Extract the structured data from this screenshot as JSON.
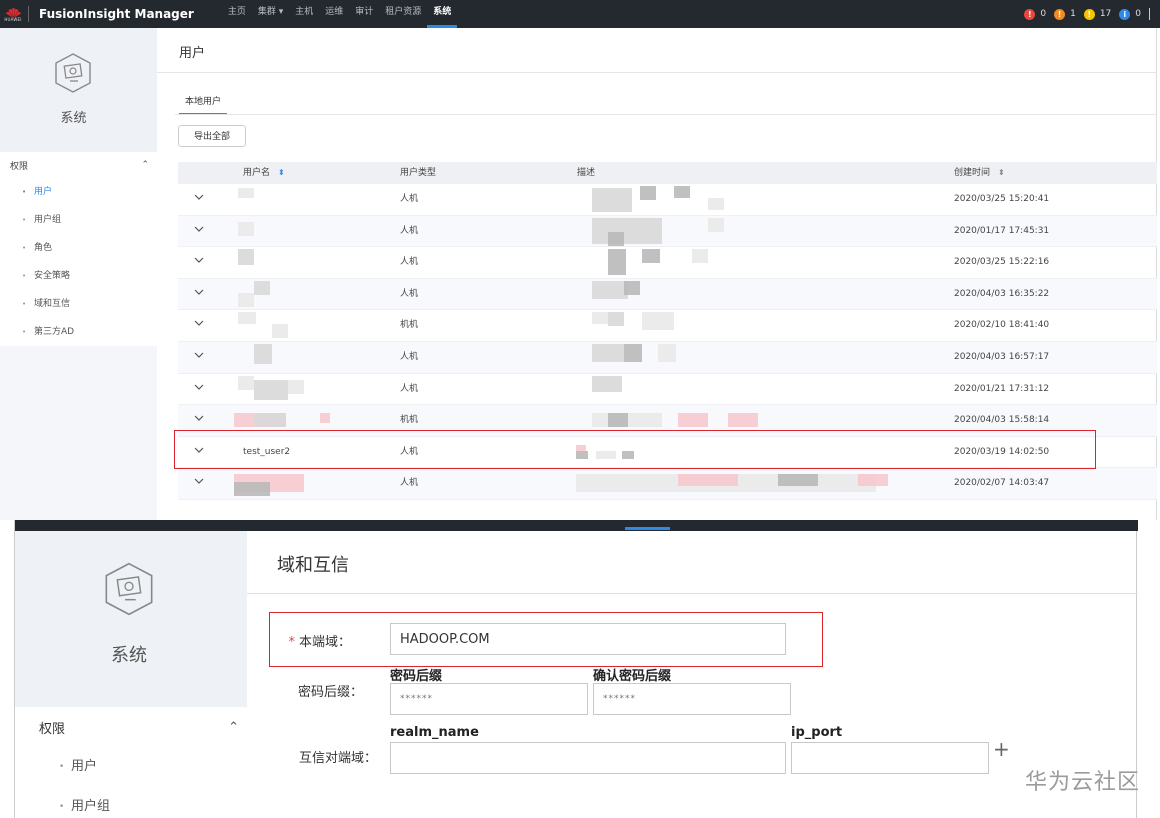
{
  "topbar": {
    "logo_text": "HUAWEI",
    "product": "FusionInsight Manager",
    "nav": [
      "主页",
      "集群 ▾",
      "主机",
      "运维",
      "审计",
      "租户资源",
      "系统"
    ],
    "active_nav": "系统",
    "alarms": [
      {
        "color": "#e5483d",
        "icon": "!",
        "count": "0"
      },
      {
        "color": "#f08a24",
        "icon": "!",
        "count": "1"
      },
      {
        "color": "#f5c400",
        "icon": "!",
        "count": "17"
      },
      {
        "color": "#2f8ae5",
        "icon": "i",
        "count": "0"
      }
    ]
  },
  "upper": {
    "sidebar": {
      "title": "系统",
      "group": "权限",
      "items": [
        "用户",
        "用户组",
        "角色",
        "安全策略",
        "域和互信",
        "第三方AD"
      ],
      "active_index": 0
    },
    "page_title": "用户",
    "tab": "本地用户",
    "export_button": "导出全部",
    "table": {
      "headers": {
        "name": "用户名",
        "type": "用户类型",
        "desc": "描述",
        "created": "创建时间"
      },
      "rows": [
        {
          "name": "",
          "type": "人机",
          "created": "2020/03/25 15:20:41"
        },
        {
          "name": "",
          "type": "人机",
          "created": "2020/01/17 17:45:31"
        },
        {
          "name": "",
          "type": "人机",
          "created": "2020/03/25 15:22:16"
        },
        {
          "name": "",
          "type": "人机",
          "created": "2020/04/03 16:35:22"
        },
        {
          "name": "",
          "type": "机机",
          "created": "2020/02/10 18:41:40"
        },
        {
          "name": "",
          "type": "人机",
          "created": "2020/04/03 16:57:17"
        },
        {
          "name": "",
          "type": "人机",
          "created": "2020/01/21 17:31:12"
        },
        {
          "name": "",
          "type": "机机",
          "created": "2020/04/03 15:58:14"
        },
        {
          "name": "test_user2",
          "type": "人机",
          "created": "2020/03/19 14:02:50"
        },
        {
          "name": "",
          "type": "人机",
          "created": "2020/02/07 14:03:47"
        }
      ]
    }
  },
  "lower": {
    "sidebar": {
      "title": "系统",
      "group": "权限",
      "items": [
        "用户",
        "用户组"
      ]
    },
    "page_title": "域和互信",
    "local_domain_label": "本端域：",
    "local_domain_value": "HADOOP.COM",
    "password_suffix_label": "密码后缀：",
    "password_suffix_head": "密码后缀",
    "confirm_suffix_head": "确认密码后缀",
    "password_placeholder": "******",
    "trust_label": "互信对端域：",
    "realm_head": "realm_name",
    "ip_head": "ip_port",
    "plus": "+"
  },
  "watermark": "华为云社区"
}
